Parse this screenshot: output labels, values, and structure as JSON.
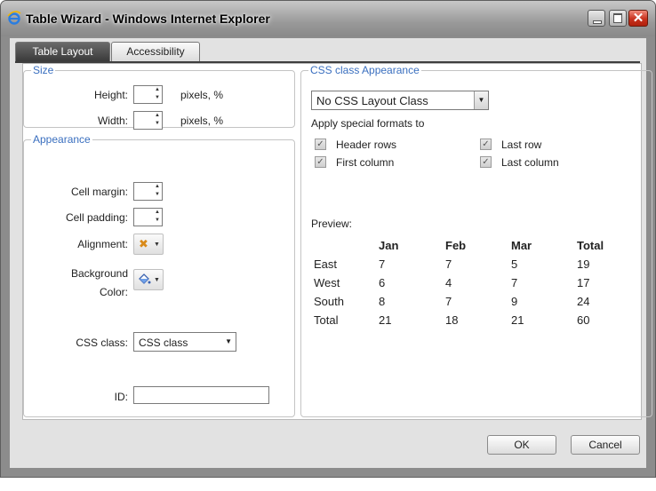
{
  "window": {
    "title": "Table Wizard - Windows Internet Explorer",
    "close_glyph": "✕"
  },
  "tabs": [
    {
      "label": "Table Layout",
      "active": true
    },
    {
      "label": "Accessibility",
      "active": false
    }
  ],
  "size": {
    "legend": "Size",
    "height_label": "Height:",
    "width_label": "Width:",
    "units_height": "pixels, %",
    "units_width": "pixels, %"
  },
  "appearance": {
    "legend": "Appearance",
    "cell_margin_label": "Cell margin:",
    "cell_padding_label": "Cell padding:",
    "alignment_label": "Alignment:",
    "background_label_line1": "Background",
    "background_label_line2": "Color:",
    "css_class_label": "CSS class:",
    "css_class_value": "CSS class",
    "id_label": "ID:",
    "id_value": ""
  },
  "css_appearance": {
    "legend": "CSS class Appearance",
    "layout_class_value": "No CSS Layout Class",
    "apply_label": "Apply special formats to",
    "checks": [
      {
        "label": "Header rows",
        "checked": true
      },
      {
        "label": "First column",
        "checked": true
      },
      {
        "label": "Last row",
        "checked": true
      },
      {
        "label": "Last column",
        "checked": true
      }
    ],
    "check_glyph": "✓"
  },
  "preview": {
    "label": "Preview:",
    "headers": [
      "",
      "Jan",
      "Feb",
      "Mar",
      "Total"
    ],
    "rows": [
      [
        "East",
        "7",
        "7",
        "5",
        "19"
      ],
      [
        "West",
        "6",
        "4",
        "7",
        "17"
      ],
      [
        "South",
        "8",
        "7",
        "9",
        "24"
      ],
      [
        "Total",
        "21",
        "18",
        "21",
        "60"
      ]
    ]
  },
  "buttons": {
    "ok": "OK",
    "cancel": "Cancel"
  },
  "icons": {
    "alignment": "x-icon",
    "background": "paint-bucket-icon",
    "alignment_glyph": "✖",
    "background_glyph": "🪣"
  },
  "colors": {
    "legend": "#3a6fbf",
    "close_button": "#c8321e"
  }
}
